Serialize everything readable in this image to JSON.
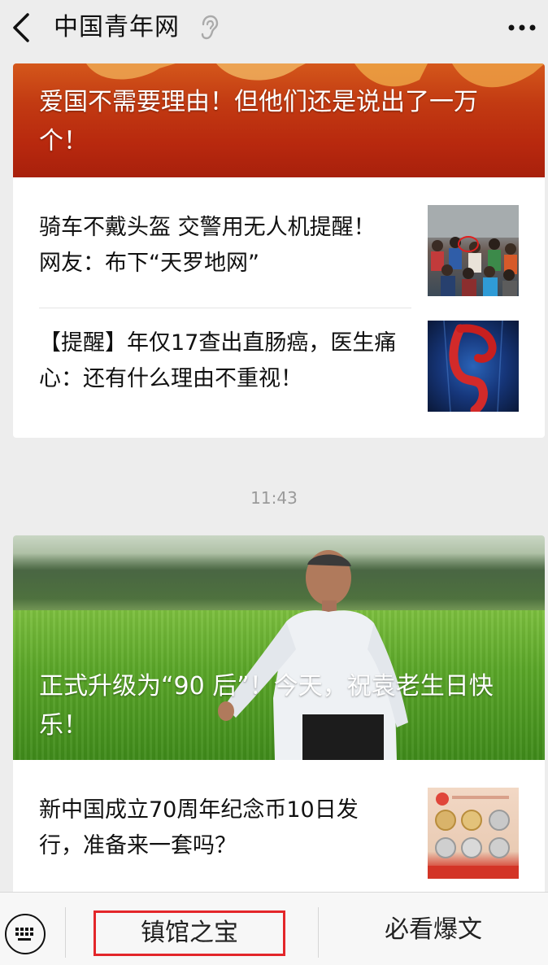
{
  "header": {
    "title": "中国青年网"
  },
  "articles": {
    "featured1": {
      "title": "爱国不需要理由！但他们还是说出了一万个！"
    },
    "item1": {
      "title": "骑车不戴头盔 交警用无人机提醒！网友：布下“天罗地网”"
    },
    "item2": {
      "title": "【提醒】年仅17查出直肠癌，医生痛心：还有什么理由不重视！"
    },
    "featured2": {
      "title": "正式升级为“90 后”！今天，祝袁老生日快乐！"
    },
    "item3": {
      "title": "新中国成立70周年纪念币10日发行，准备来一套吗？"
    }
  },
  "timestamp": "11:43",
  "menu": {
    "item1": "镇馆之宝",
    "item2": "必看爆文"
  },
  "colors": {
    "background": "#ededed",
    "highlight_border": "#e3262a"
  },
  "icons": {
    "back": "chevron-left-icon",
    "ear": "ear-icon",
    "more": "more-dots-icon",
    "keyboard": "keyboard-icon"
  }
}
